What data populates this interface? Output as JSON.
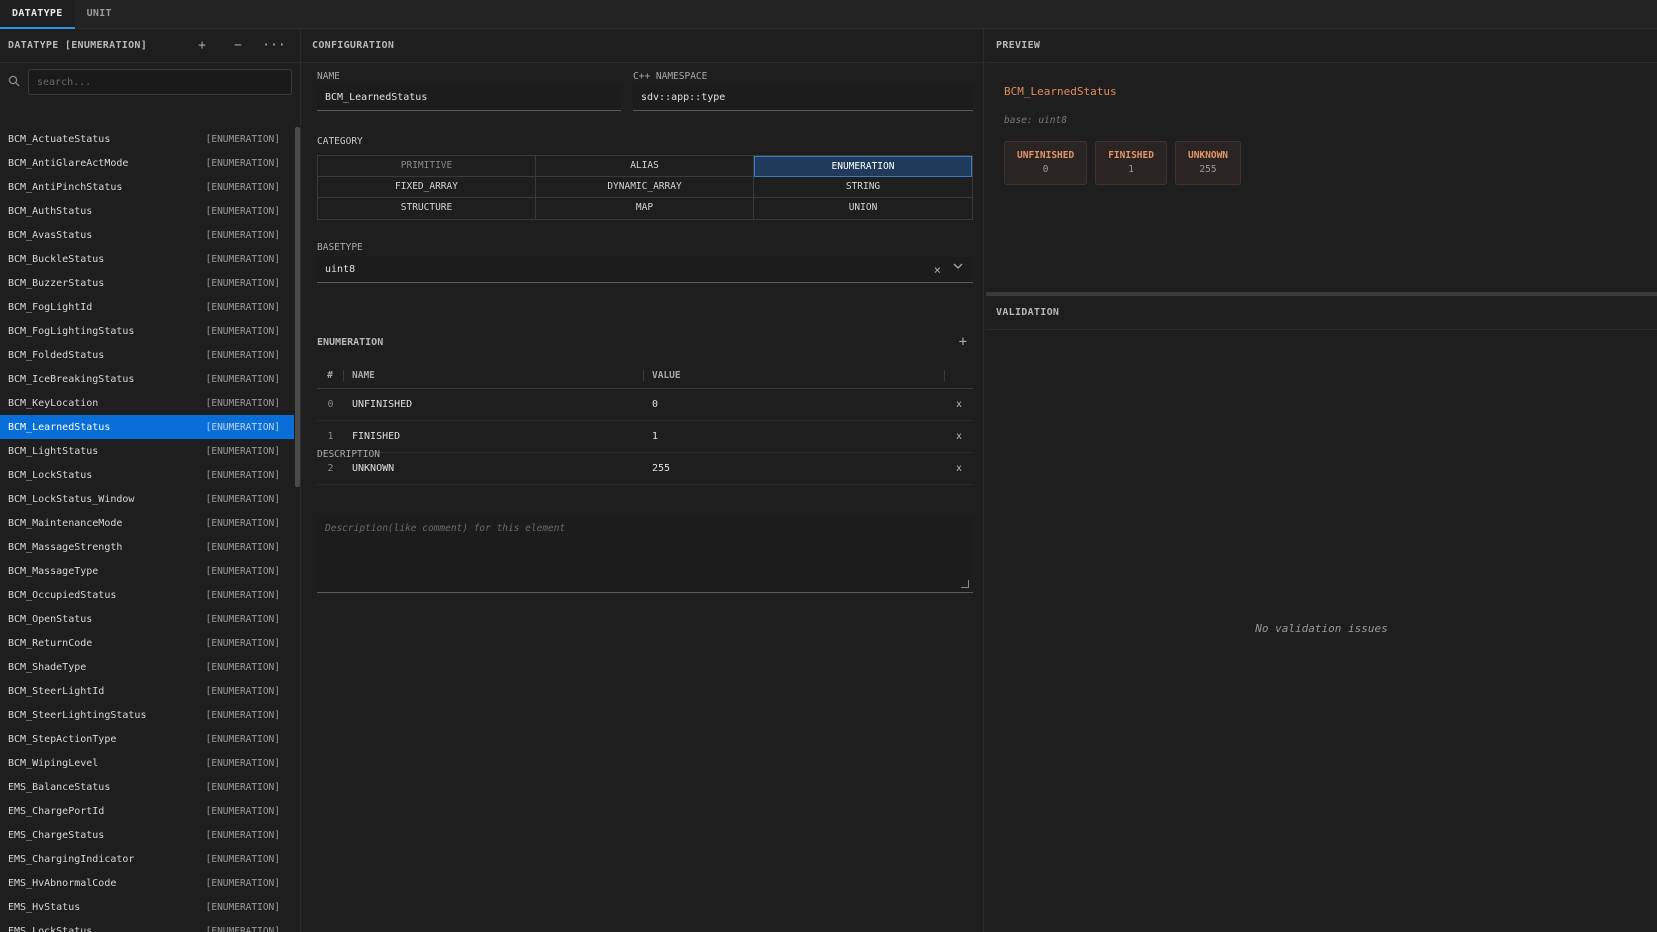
{
  "tabs": [
    "DATATYPE",
    "UNIT"
  ],
  "sidebar": {
    "title": "DATATYPE [ENUMERATION]",
    "add": "+",
    "remove": "−",
    "more": "···",
    "search_placeholder": "search...",
    "items": [
      {
        "name": "BCM_ActuateStatus",
        "type": "[ENUMERATION]"
      },
      {
        "name": "BCM_AntiGlareActMode",
        "type": "[ENUMERATION]"
      },
      {
        "name": "BCM_AntiPinchStatus",
        "type": "[ENUMERATION]"
      },
      {
        "name": "BCM_AuthStatus",
        "type": "[ENUMERATION]"
      },
      {
        "name": "BCM_AvasStatus",
        "type": "[ENUMERATION]"
      },
      {
        "name": "BCM_BuckleStatus",
        "type": "[ENUMERATION]"
      },
      {
        "name": "BCM_BuzzerStatus",
        "type": "[ENUMERATION]"
      },
      {
        "name": "BCM_FogLightId",
        "type": "[ENUMERATION]"
      },
      {
        "name": "BCM_FogLightingStatus",
        "type": "[ENUMERATION]"
      },
      {
        "name": "BCM_FoldedStatus",
        "type": "[ENUMERATION]"
      },
      {
        "name": "BCM_IceBreakingStatus",
        "type": "[ENUMERATION]"
      },
      {
        "name": "BCM_KeyLocation",
        "type": "[ENUMERATION]"
      },
      {
        "name": "BCM_LearnedStatus",
        "type": "[ENUMERATION]",
        "selected": true
      },
      {
        "name": "BCM_LightStatus",
        "type": "[ENUMERATION]"
      },
      {
        "name": "BCM_LockStatus",
        "type": "[ENUMERATION]"
      },
      {
        "name": "BCM_LockStatus_Window",
        "type": "[ENUMERATION]"
      },
      {
        "name": "BCM_MaintenanceMode",
        "type": "[ENUMERATION]"
      },
      {
        "name": "BCM_MassageStrength",
        "type": "[ENUMERATION]"
      },
      {
        "name": "BCM_MassageType",
        "type": "[ENUMERATION]"
      },
      {
        "name": "BCM_OccupiedStatus",
        "type": "[ENUMERATION]"
      },
      {
        "name": "BCM_OpenStatus",
        "type": "[ENUMERATION]"
      },
      {
        "name": "BCM_ReturnCode",
        "type": "[ENUMERATION]"
      },
      {
        "name": "BCM_ShadeType",
        "type": "[ENUMERATION]"
      },
      {
        "name": "BCM_SteerLightId",
        "type": "[ENUMERATION]"
      },
      {
        "name": "BCM_SteerLightingStatus",
        "type": "[ENUMERATION]"
      },
      {
        "name": "BCM_StepActionType",
        "type": "[ENUMERATION]"
      },
      {
        "name": "BCM_WipingLevel",
        "type": "[ENUMERATION]"
      },
      {
        "name": "EMS_BalanceStatus",
        "type": "[ENUMERATION]"
      },
      {
        "name": "EMS_ChargePortId",
        "type": "[ENUMERATION]"
      },
      {
        "name": "EMS_ChargeStatus",
        "type": "[ENUMERATION]"
      },
      {
        "name": "EMS_ChargingIndicator",
        "type": "[ENUMERATION]"
      },
      {
        "name": "EMS_HvAbnormalCode",
        "type": "[ENUMERATION]"
      },
      {
        "name": "EMS_HvStatus",
        "type": "[ENUMERATION]"
      },
      {
        "name": "EMS_LockStatus",
        "type": "[ENUMERATION]"
      }
    ]
  },
  "config": {
    "header": "CONFIGURATION",
    "name_label": "NAME",
    "name_value": "BCM_LearnedStatus",
    "namespace_label": "C++ NAMESPACE",
    "namespace_value": "sdv::app::type",
    "category_label": "CATEGORY",
    "categories": [
      {
        "label": "PRIMITIVE",
        "state": "dim"
      },
      {
        "label": "ALIAS",
        "state": ""
      },
      {
        "label": "ENUMERATION",
        "state": "active"
      },
      {
        "label": "FIXED_ARRAY",
        "state": ""
      },
      {
        "label": "DYNAMIC_ARRAY",
        "state": ""
      },
      {
        "label": "STRING",
        "state": ""
      },
      {
        "label": "STRUCTURE",
        "state": ""
      },
      {
        "label": "MAP",
        "state": ""
      },
      {
        "label": "UNION",
        "state": ""
      }
    ],
    "basetype_label": "BASETYPE",
    "basetype_value": "uint8",
    "basetype_clear": "×",
    "basetype_chevron": "⌵",
    "enumeration_label": "ENUMERATION",
    "enum_add": "+",
    "enum_columns": {
      "idx": "#",
      "name": "NAME",
      "value": "VALUE"
    },
    "enum_rows": [
      {
        "idx": "0",
        "name": "UNFINISHED",
        "value": "0",
        "del": "x"
      },
      {
        "idx": "1",
        "name": "FINISHED",
        "value": "1",
        "del": "x"
      },
      {
        "idx": "2",
        "name": "UNKNOWN",
        "value": "255",
        "del": "x"
      }
    ],
    "description_label": "DESCRIPTION",
    "description_placeholder": "Description(like comment) for this element"
  },
  "preview": {
    "header": "PREVIEW",
    "title": "BCM_LearnedStatus",
    "base": "base: uint8",
    "chips": [
      {
        "name": "UNFINISHED",
        "value": "0"
      },
      {
        "name": "FINISHED",
        "value": "1"
      },
      {
        "name": "UNKNOWN",
        "value": "255"
      }
    ]
  },
  "validation": {
    "header": "VALIDATION",
    "empty": "No validation issues"
  },
  "icons": {
    "search": "search-icon"
  }
}
